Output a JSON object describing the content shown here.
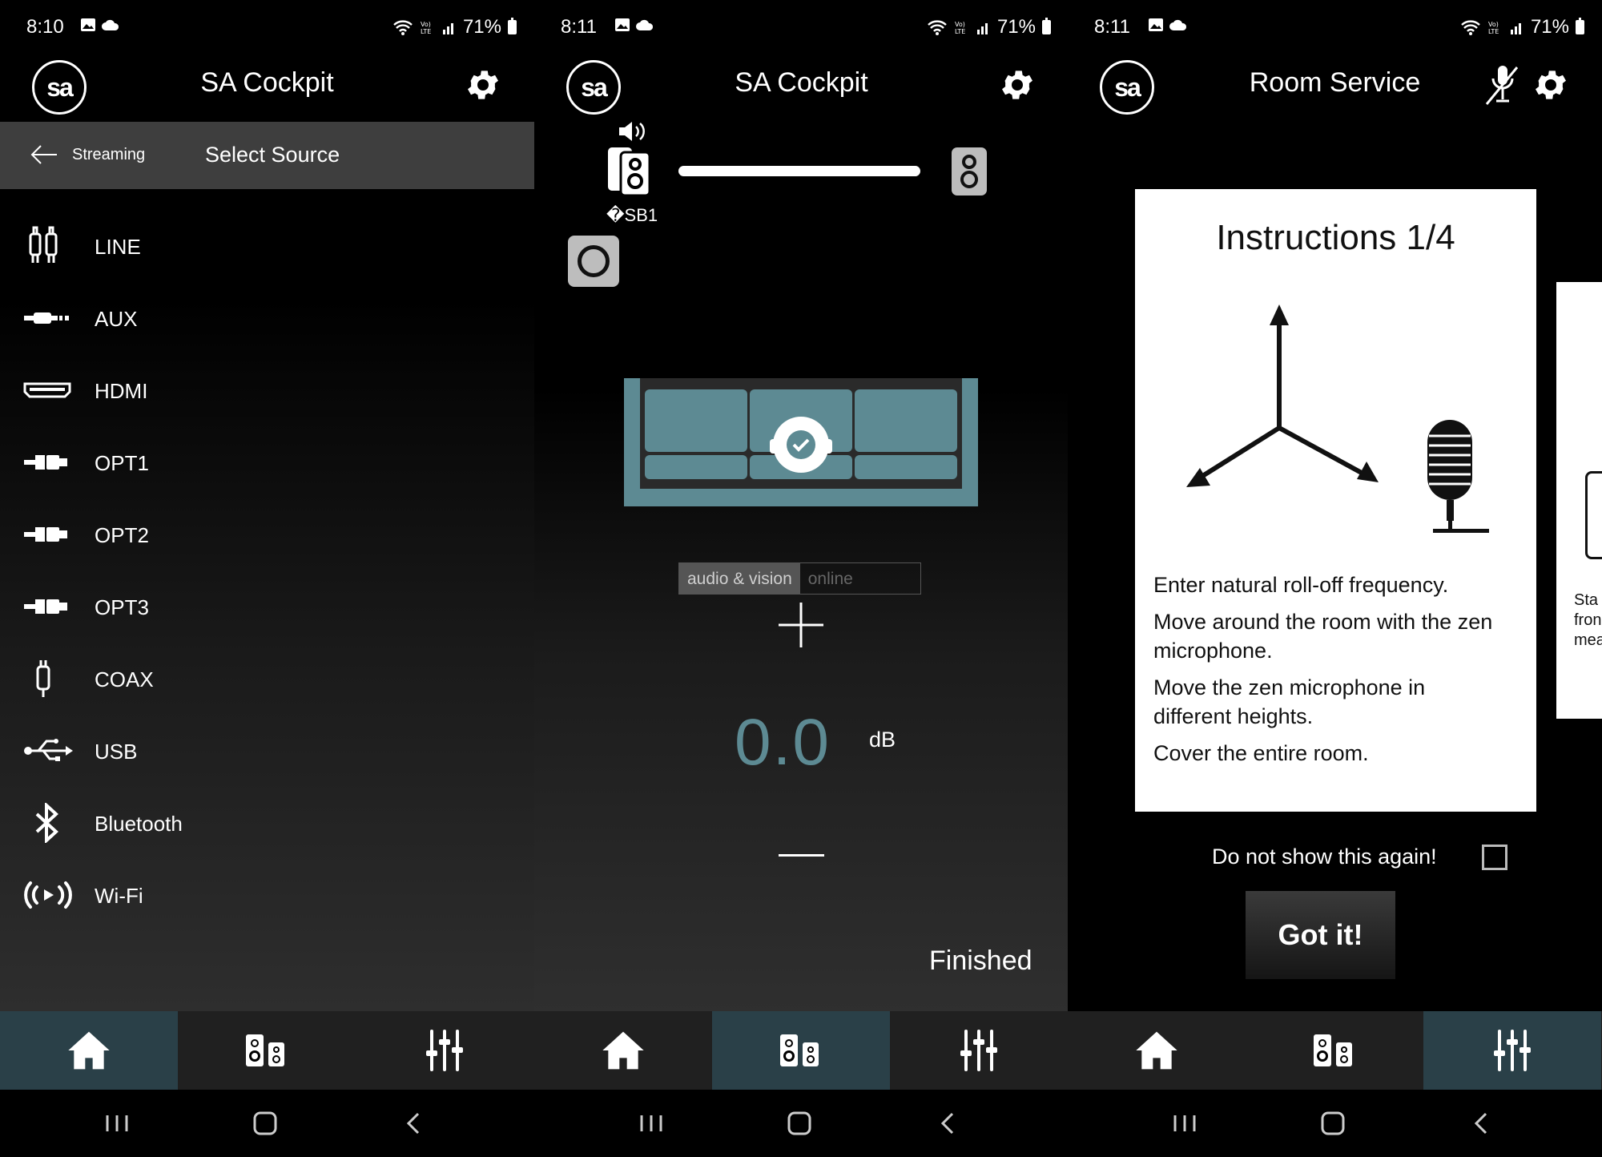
{
  "panels": [
    {
      "status": {
        "time": "8:10",
        "battery": "71%"
      },
      "header": {
        "title": "SA Cockpit"
      },
      "subbar": {
        "back_label": "Streaming",
        "title": "Select Source"
      },
      "sources": [
        {
          "label": "LINE",
          "icon": "rca-plug-icon"
        },
        {
          "label": "AUX",
          "icon": "jack-plug-icon"
        },
        {
          "label": "HDMI",
          "icon": "hdmi-icon"
        },
        {
          "label": "OPT1",
          "icon": "optical-icon"
        },
        {
          "label": "OPT2",
          "icon": "optical-icon"
        },
        {
          "label": "OPT3",
          "icon": "optical-icon"
        },
        {
          "label": "COAX",
          "icon": "coax-icon"
        },
        {
          "label": "USB",
          "icon": "usb-icon"
        },
        {
          "label": "Bluetooth",
          "icon": "bluetooth-icon"
        },
        {
          "label": "Wi-Fi",
          "icon": "wifi-broadcast-icon"
        }
      ],
      "active_tab": "home"
    },
    {
      "status": {
        "time": "8:11",
        "battery": "71%"
      },
      "header": {
        "title": "SA Cockpit"
      },
      "speaker_label": "�SB1",
      "watermark": {
        "part1": "audio & vision",
        "part2": "online"
      },
      "level": {
        "value": "0.0",
        "unit": "dB"
      },
      "finished_label": "Finished",
      "active_tab": "speakers"
    },
    {
      "status": {
        "time": "8:11",
        "battery": "71%"
      },
      "header": {
        "title": "Room Service"
      },
      "instructions": {
        "title": "Instructions 1/4",
        "lines": [
          "Enter natural roll-off frequency.",
          "Move around the room with the zen microphone.",
          "Move the zen microphone in different heights.",
          "Cover the entire room."
        ]
      },
      "next_card_text": "Sta\nfron\nmea",
      "dont_show_label": "Do not show this again!",
      "got_it_label": "Got it!",
      "active_tab": "equalizer"
    }
  ],
  "colors": {
    "accent": "#5d8a93",
    "active_tab": "#2a4048",
    "sofa": "#5d8a93"
  }
}
